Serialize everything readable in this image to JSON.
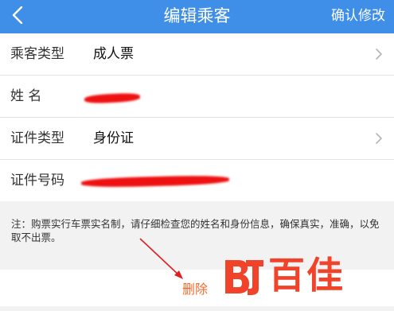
{
  "header": {
    "back_icon": "chevron-left-icon",
    "title": "编辑乘客",
    "confirm_label": "确认修改",
    "accent_color": "#3f8ee8"
  },
  "form": {
    "rows": [
      {
        "label": "乘客类型",
        "value": "成人票",
        "has_chevron": true
      },
      {
        "label": "姓 名",
        "value": "",
        "redacted": true
      },
      {
        "label": "证件类型",
        "value": "身份证",
        "has_chevron": true
      },
      {
        "label": "证件号码",
        "value": "",
        "redacted": true
      }
    ]
  },
  "notice": "注：购票实行车票实名制，请仔细检查您的姓名和身份信息，确保真实，准确，以免取不出票。",
  "footer": {
    "delete_label": "删除",
    "delete_color": "#f06a2e"
  },
  "watermark": {
    "text": "百佳",
    "color": "#f0432a"
  },
  "annotation": {
    "arrow_color": "#e02020"
  }
}
